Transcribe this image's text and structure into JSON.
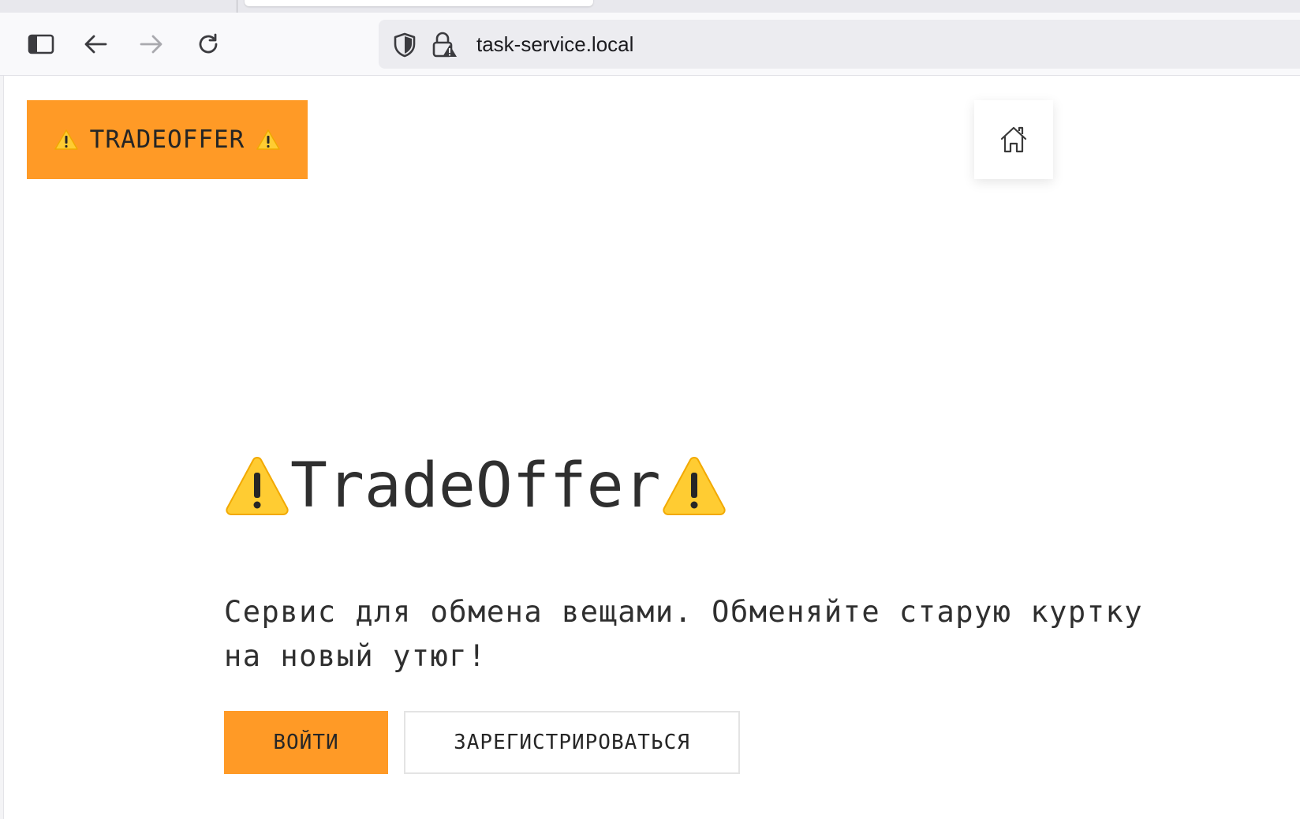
{
  "browser": {
    "url": "task-service.local",
    "icons": {
      "sidebar": "sidebar-toggle-icon",
      "back": "arrow-left-icon",
      "forward": "arrow-right-icon",
      "reload": "reload-icon",
      "shield": "shield-icon",
      "lock": "lock-warning-icon"
    }
  },
  "header": {
    "logo_text": "TRADEOFFER",
    "home_icon": "home-icon"
  },
  "hero": {
    "title": "TradeOffer",
    "description": "Сервис для обмена вещами. Обменяйте старую куртку на новый утюг!"
  },
  "actions": {
    "login_label": "ВОЙТИ",
    "register_label": "ЗАРЕГИСТРИРОВАТЬСЯ"
  },
  "colors": {
    "accent": "#ff9a26",
    "text": "#2f2f2f",
    "warning_yellow": "#ffcc32"
  }
}
